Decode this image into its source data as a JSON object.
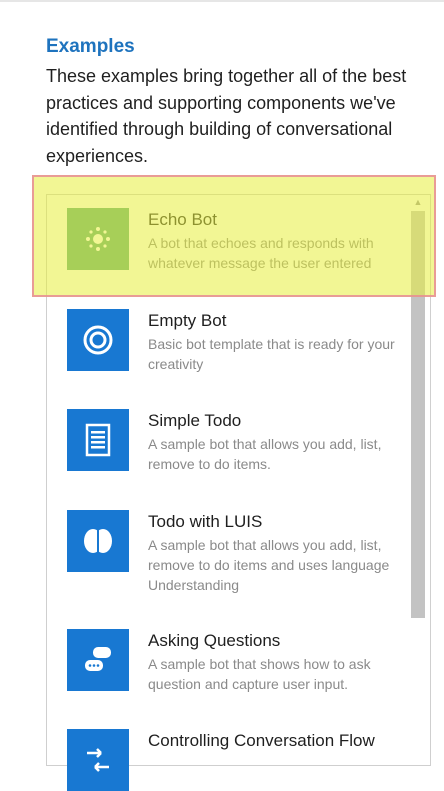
{
  "section": {
    "heading": "Examples",
    "intro": "These examples bring together all of the best practices and supporting components we've identified through building of conversational experiences."
  },
  "examples": [
    {
      "title": "Echo Bot",
      "description": "A bot that echoes and responds with whatever message the user entered",
      "icon": "echo-sparkle-icon"
    },
    {
      "title": "Empty Bot",
      "description": "Basic bot template that is ready for your creativity",
      "icon": "empty-ring-icon"
    },
    {
      "title": "Simple Todo",
      "description": "A sample bot that allows you add, list, remove to do items.",
      "icon": "todo-list-icon"
    },
    {
      "title": "Todo with LUIS",
      "description": "A sample bot that allows you add, list, remove to do items and uses language Understanding",
      "icon": "brain-icon"
    },
    {
      "title": "Asking Questions",
      "description": "A sample bot that shows how to ask question and capture user input.",
      "icon": "chat-bubbles-icon"
    },
    {
      "title": "Controlling Conversation Flow",
      "description": "",
      "icon": "flow-arrows-icon"
    }
  ],
  "colors": {
    "heading": "#1e73be",
    "tile_blue": "#1878d2",
    "tile_green": "#5aa97a",
    "highlight_fill": "#e8ee3c",
    "highlight_border": "#e88c96"
  }
}
